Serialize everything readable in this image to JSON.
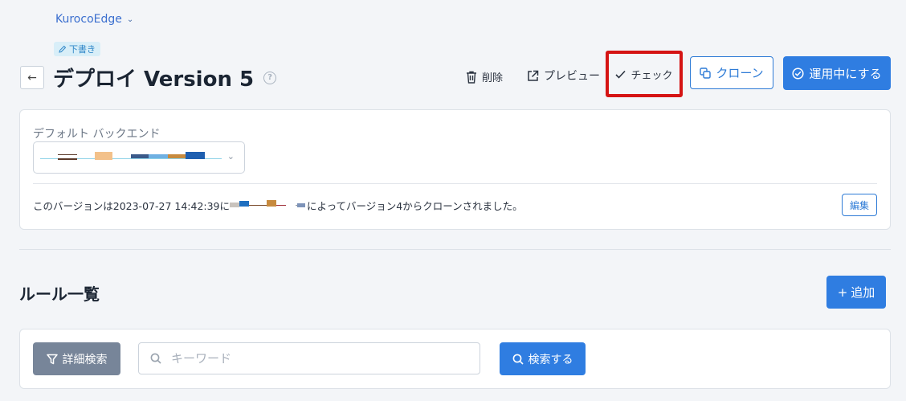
{
  "header": {
    "org_name": "KurocoEdge",
    "status_badge": "下書き",
    "page_title": "デプロイ Version 5",
    "help_icon": "?"
  },
  "actions": {
    "delete_label": "削除",
    "preview_label": "プレビュー",
    "check_label": "チェック",
    "clone_label": "クローン",
    "activate_label": "運用中にする"
  },
  "backend": {
    "label": "デフォルト バックエンド"
  },
  "version_info": {
    "prefix": "このバージョンは2023-07-27 14:42:39に",
    "suffix": "によってバージョン4からクローンされました。",
    "edit_label": "編集"
  },
  "rules": {
    "title": "ルール一覧",
    "add_label": "追加",
    "filter_label": "詳細検索",
    "search_placeholder": "キーワード",
    "search_value": "",
    "search_button_label": "検索する"
  },
  "colors": {
    "accent": "#2f7de1",
    "highlight_border": "#d51414",
    "filter_button": "#778599"
  }
}
